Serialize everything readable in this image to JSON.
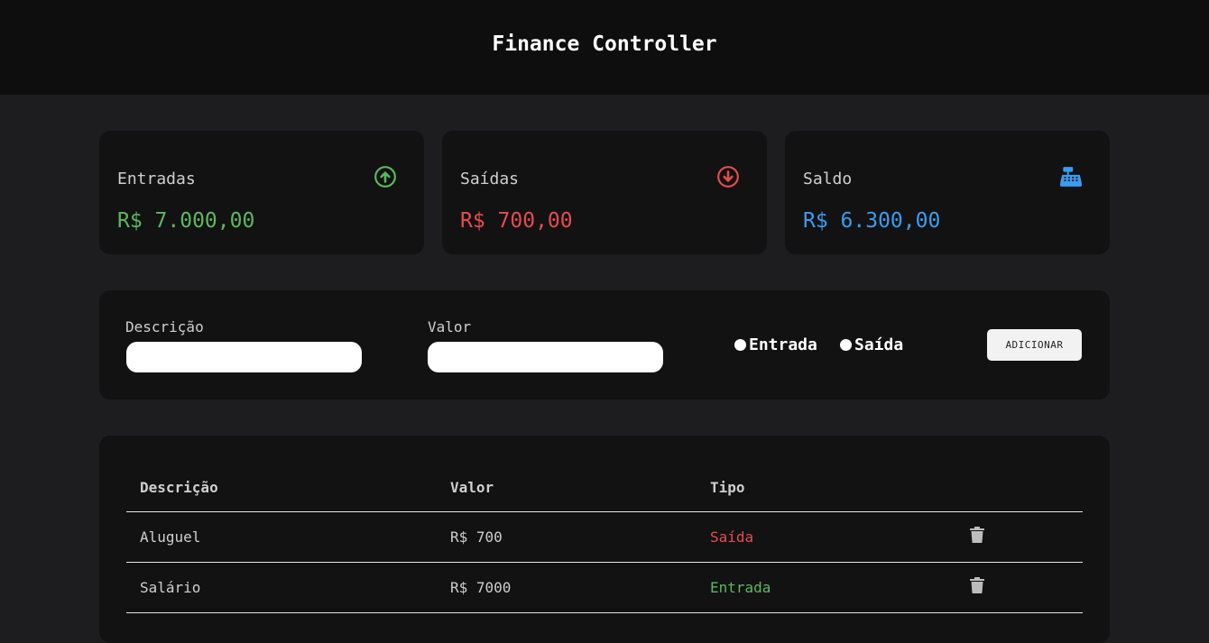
{
  "header": {
    "title": "Finance Controller"
  },
  "summary": {
    "income": {
      "label": "Entradas",
      "amount": "R$ 7.000,00",
      "icon": "arrow-up-circle-icon",
      "color": "#5cb85c"
    },
    "expense": {
      "label": "Saídas",
      "amount": "R$ 700,00",
      "icon": "arrow-down-circle-icon",
      "color": "#e74c4c"
    },
    "balance": {
      "label": "Saldo",
      "amount": "R$ 6.300,00",
      "icon": "cash-register-icon",
      "color": "#3b9cf0"
    }
  },
  "form": {
    "description_label": "Descrição",
    "description_value": "",
    "value_label": "Valor",
    "value_value": "",
    "radio_income_label": "Entrada",
    "radio_expense_label": "Saída",
    "add_button_label": "ADICIONAR"
  },
  "table": {
    "columns": [
      "Descrição",
      "Valor",
      "Tipo"
    ],
    "rows": [
      {
        "description": "Aluguel",
        "value": "R$ 700",
        "type": "Saída",
        "type_color": "#e74c4c"
      },
      {
        "description": "Salário",
        "value": "R$ 7000",
        "type": "Entrada",
        "type_color": "#5cb85c"
      }
    ]
  }
}
